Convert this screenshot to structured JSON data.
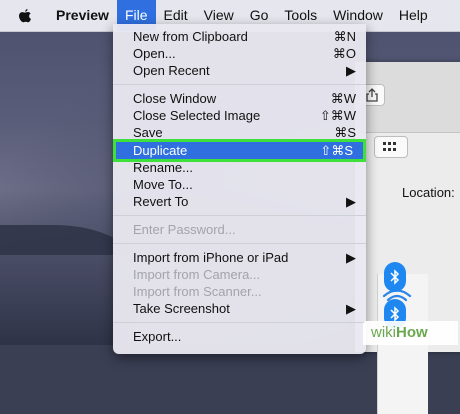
{
  "menubar": {
    "apple_icon": "apple-logo",
    "items": [
      "Preview",
      "File",
      "Edit",
      "View",
      "Go",
      "Tools",
      "Window",
      "Help"
    ],
    "active": "File"
  },
  "file_menu": {
    "items": [
      {
        "label": "New from Clipboard",
        "shortcut": "⌘N"
      },
      {
        "label": "Open...",
        "shortcut": "⌘O"
      },
      {
        "label": "Open Recent",
        "shortcut": "▶"
      },
      {
        "label": "Close Window",
        "shortcut": "⌘W"
      },
      {
        "label": "Close Selected Image",
        "shortcut": "⇧⌘W"
      },
      {
        "label": "Save",
        "shortcut": "⌘S"
      },
      {
        "label": "Duplicate",
        "shortcut": "⇧⌘S",
        "highlighted": true
      },
      {
        "label": "Rename...",
        "shortcut": ""
      },
      {
        "label": "Move To...",
        "shortcut": ""
      },
      {
        "label": "Revert To",
        "shortcut": "▶"
      },
      {
        "label": "Enter Password...",
        "shortcut": "",
        "disabled": true
      },
      {
        "label": "Import from iPhone or iPad",
        "shortcut": "▶"
      },
      {
        "label": "Import from Camera...",
        "shortcut": "",
        "disabled": true
      },
      {
        "label": "Import from Scanner...",
        "shortcut": "",
        "disabled": true
      },
      {
        "label": "Take Screenshot",
        "shortcut": "▶"
      },
      {
        "label": "Export...",
        "shortcut": ""
      }
    ],
    "highlight_color": "#2f6fe0",
    "callout_color": "#3ee03a"
  },
  "background_window": {
    "location_label": "Location:"
  },
  "watermark": {
    "wiki": "wiki",
    "how": "How"
  }
}
